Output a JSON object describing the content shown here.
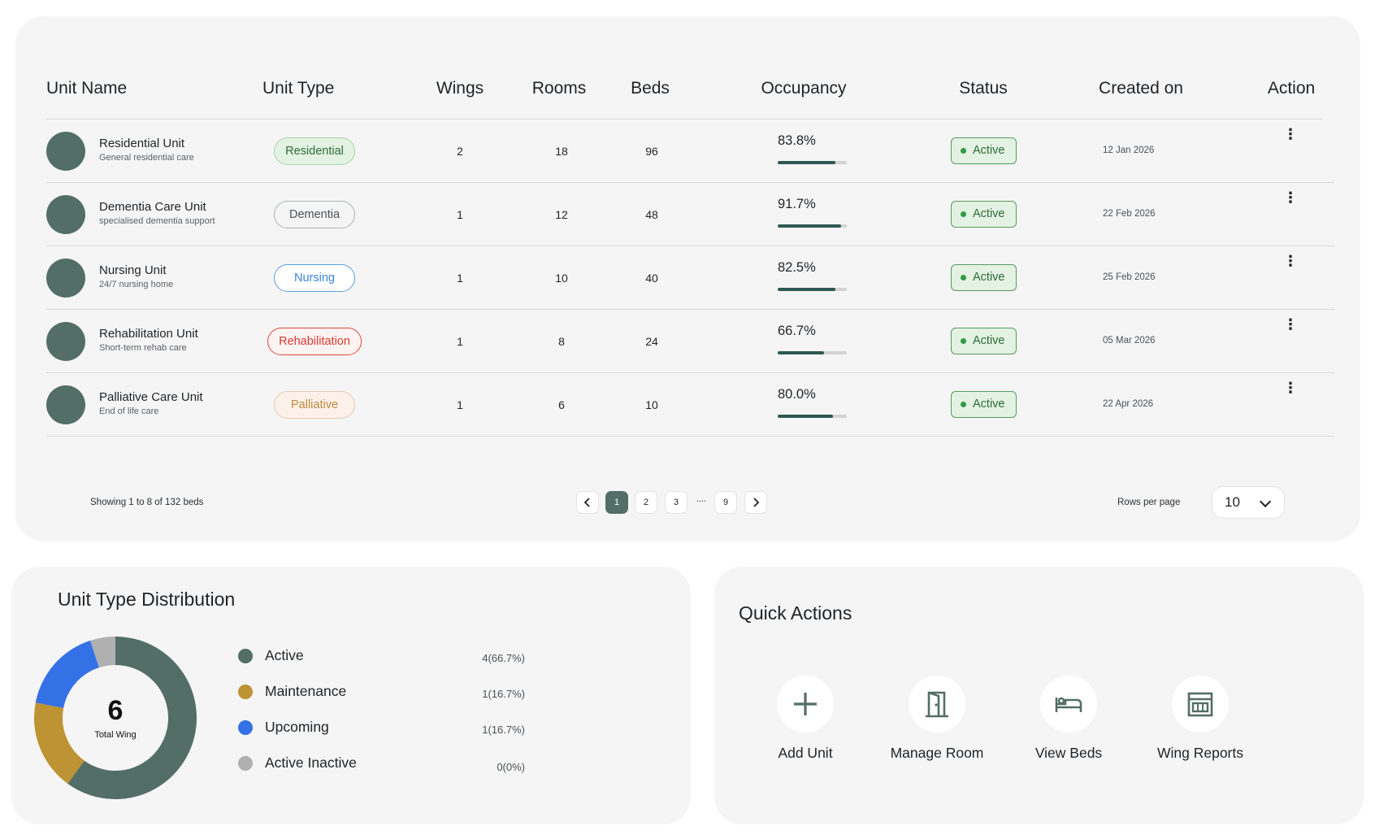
{
  "table": {
    "headers": {
      "unit_name": "Unit Name",
      "unit_type": "Unit Type",
      "wings": "Wings",
      "rooms": "Rooms",
      "beds": "Beds",
      "occupancy": "Occupancy",
      "status": "Status",
      "created_on": "Created on",
      "action": "Action"
    },
    "rows": [
      {
        "name": "Residential Unit",
        "desc": "General residential care",
        "type": "Residential",
        "type_color": "#2e6b37",
        "type_bg": "#e3f2e3",
        "type_border": "#a9d3ad",
        "wings": "2",
        "rooms": "18",
        "beds": "96",
        "occupancy": "83.8%",
        "occupancy_value": 83.8,
        "status": "Active",
        "created": "12 Jan 2026"
      },
      {
        "name": "Dementia Care Unit",
        "desc": "specialised dementia support",
        "type": "Dementia",
        "type_color": "#4a5055",
        "type_bg": "#f5f5f5",
        "type_border": "#a9b4b0",
        "wings": "1",
        "rooms": "12",
        "beds": "48",
        "occupancy": "91.7%",
        "occupancy_value": 91.7,
        "status": "Active",
        "created": "22 Feb 2026"
      },
      {
        "name": "Nursing Unit",
        "desc": "24/7 nursing home",
        "type": "Nursing",
        "type_color": "#3b84d6",
        "type_bg": "#ffffff",
        "type_border": "#5a9ee3",
        "wings": "1",
        "rooms": "10",
        "beds": "40",
        "occupancy": "82.5%",
        "occupancy_value": 82.5,
        "status": "Active",
        "created": "25 Feb 2026"
      },
      {
        "name": "Rehabilitation Unit",
        "desc": "Short-term rehab care",
        "type": "Rehabilitation",
        "type_color": "#d63a2f",
        "type_bg": "#fdf3f2",
        "type_border": "#e0453a",
        "wings": "1",
        "rooms": "8",
        "beds": "24",
        "occupancy": "66.7%",
        "occupancy_value": 66.7,
        "status": "Active",
        "created": "05 Mar 2026"
      },
      {
        "name": "Palliative Care Unit",
        "desc": "End of life care",
        "type": "Palliative",
        "type_color": "#c08a3a",
        "type_bg": "#fbf1ea",
        "type_border": "#e8c9b0",
        "wings": "1",
        "rooms": "6",
        "beds": "10",
        "occupancy": "80.0%",
        "occupancy_value": 80.0,
        "status": "Active",
        "created": "22 Apr 2026"
      }
    ]
  },
  "pagination": {
    "showing": "Showing 1 to 8 of 132 beds",
    "pages": [
      "1",
      "2",
      "3",
      "9"
    ],
    "current": "1",
    "ellipsis": "....",
    "rows_per_page_label": "Rows per page",
    "rows_per_page_value": "10"
  },
  "distribution": {
    "title": "Unit Type Distribution",
    "total": "6",
    "total_label": "Total Wing",
    "items": [
      {
        "label": "Active",
        "value": "4(66.7%)",
        "count": 4,
        "color": "#536e66"
      },
      {
        "label": "Maintenance",
        "value": "1(16.7%)",
        "count": 1,
        "color": "#bd9333"
      },
      {
        "label": "Upcoming",
        "value": "1(16.7%)",
        "count": 1,
        "color": "#3571e6"
      },
      {
        "label": "Active Inactive",
        "value": "0(0%)",
        "count": 0,
        "color": "#b0b0b0"
      }
    ]
  },
  "quick_actions": {
    "title": "Quick Actions",
    "items": [
      {
        "label": "Add Unit",
        "icon": "plus-icon"
      },
      {
        "label": "Manage Room",
        "icon": "door-icon"
      },
      {
        "label": "View Beds",
        "icon": "bed-icon"
      },
      {
        "label": "Wing Reports",
        "icon": "building-icon"
      }
    ]
  }
}
